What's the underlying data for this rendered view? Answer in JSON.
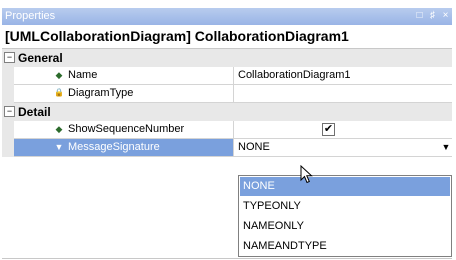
{
  "window": {
    "title": "Properties",
    "float_glyph": "□",
    "pin_glyph": "♯",
    "close_glyph": "×"
  },
  "header": {
    "text": "[UMLCollaborationDiagram] CollaborationDiagram1"
  },
  "categories": [
    {
      "label": "General",
      "toggle": "−"
    },
    {
      "label": "Detail",
      "toggle": "−"
    }
  ],
  "properties": [
    {
      "name": "Name",
      "value": "CollaborationDiagram1",
      "icon": "diamond-icon",
      "glyph": "◆"
    },
    {
      "name": "DiagramType",
      "value": "",
      "icon": "lock-icon",
      "glyph": "🔒"
    },
    {
      "name": "ShowSequenceNumber",
      "value": "",
      "checked": true,
      "check_glyph": "✔",
      "icon": "diamond-icon",
      "glyph": "◆"
    },
    {
      "name": "MessageSignature",
      "value": "NONE",
      "icon": "triangle-down-icon",
      "glyph": "▼",
      "selected": true,
      "dropdown_glyph": "▼"
    }
  ],
  "dropdown": {
    "options": [
      "NONE",
      "TYPEONLY",
      "NAMEONLY",
      "NAMEANDTYPE"
    ],
    "highlighted": "NONE"
  },
  "colors": {
    "titlebar": "#99b4e6",
    "selection": "#7aa0dd",
    "category_bg": "#e8e8e8"
  }
}
